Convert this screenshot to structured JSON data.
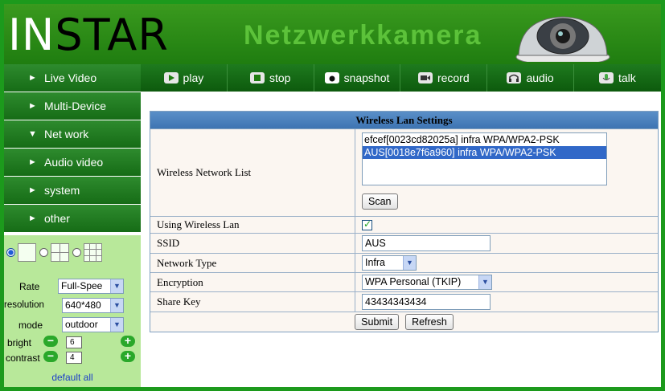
{
  "header": {
    "logo_part1": "IN",
    "logo_part2": "STAR",
    "subtitle": "Netzwerkkamera"
  },
  "toolbar": [
    {
      "label": "play",
      "icon": "play-icon"
    },
    {
      "label": "stop",
      "icon": "stop-icon"
    },
    {
      "label": "snapshot",
      "icon": "snapshot-icon"
    },
    {
      "label": "record",
      "icon": "record-icon"
    },
    {
      "label": "audio",
      "icon": "audio-icon"
    },
    {
      "label": "talk",
      "icon": "talk-icon"
    }
  ],
  "sidebar": {
    "items": [
      {
        "label": "Live Video",
        "arrow": "►"
      },
      {
        "label": "Multi-Device",
        "arrow": "►"
      },
      {
        "label": "Net work",
        "arrow": "▼"
      },
      {
        "label": "Audio video",
        "arrow": "►"
      },
      {
        "label": "system",
        "arrow": "►"
      },
      {
        "label": "other",
        "arrow": "►"
      }
    ],
    "controls": {
      "rate_label": "Rate",
      "rate_value": "Full-Spee",
      "resolution_label": "resolution",
      "resolution_value": "640*480",
      "mode_label": "mode",
      "mode_value": "outdoor",
      "bright_label": "bright",
      "bright_value": "6",
      "contrast_label": "contrast",
      "contrast_value": "4",
      "minus": "−",
      "plus": "+",
      "default_all": "default all",
      "dropdown_arrow": "▼"
    }
  },
  "form": {
    "title": "Wireless Lan Settings",
    "network_list_label": "Wireless Network List",
    "networks": [
      {
        "text": "efcef[0023cd82025a] infra WPA/WPA2-PSK",
        "selected": false
      },
      {
        "text": "AUS[0018e7f6a960] infra WPA/WPA2-PSK",
        "selected": true
      }
    ],
    "scan_label": "Scan",
    "using_label": "Using Wireless Lan",
    "using_checked": true,
    "ssid_label": "SSID",
    "ssid_value": "AUS",
    "type_label": "Network Type",
    "type_value": "Infra",
    "encryption_label": "Encryption",
    "encryption_value": "WPA Personal (TKIP)",
    "sharekey_label": "Share Key",
    "sharekey_value": "43434343434",
    "submit_label": "Submit",
    "refresh_label": "Refresh"
  },
  "colors": {
    "frame_green": "#1c9a1c",
    "nav_green": "#1f7d10",
    "panel_green": "#b8e89a",
    "title_blue": "#4a82c0",
    "selected_blue": "#3168c8"
  }
}
